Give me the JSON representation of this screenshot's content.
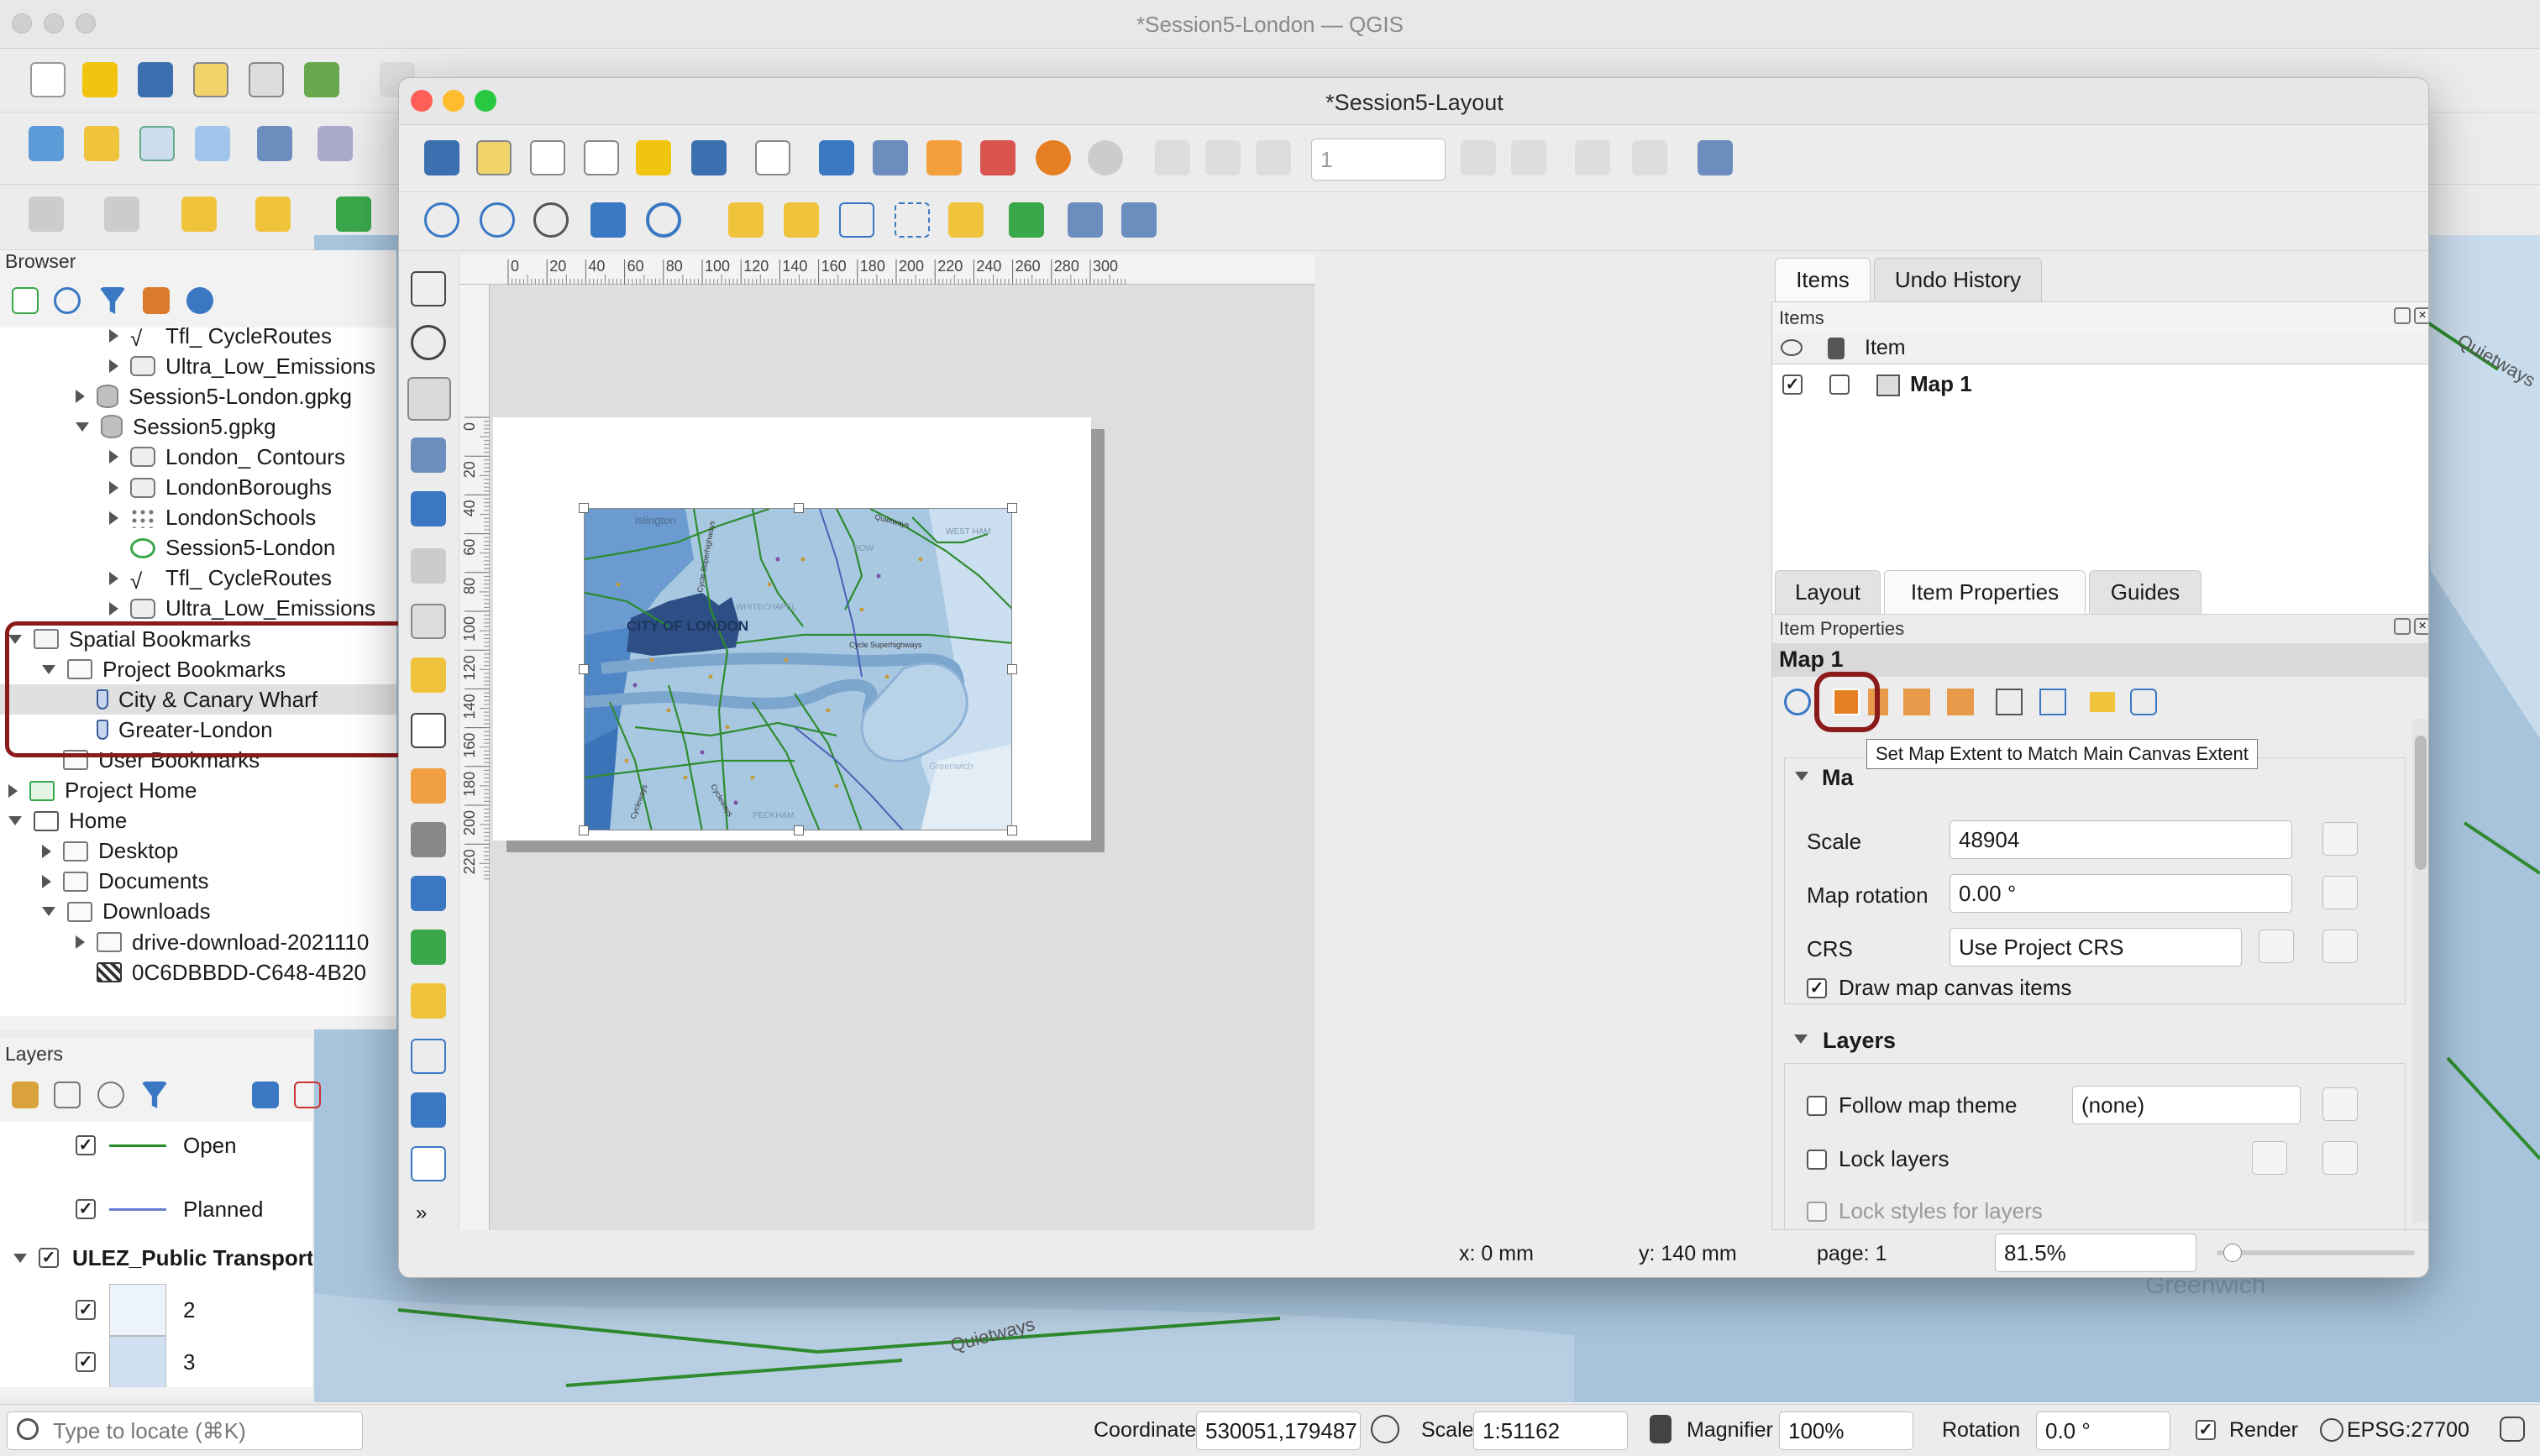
{
  "main_window": {
    "title": "*Session5-London — QGIS"
  },
  "layout_window": {
    "title": "*Session5-Layout",
    "page_input": "1"
  },
  "browser": {
    "title": "Browser",
    "rows": [
      {
        "label": "Tfl_ CycleRoutes",
        "indent": 3,
        "expander": "right",
        "icon": "line-layer-icon"
      },
      {
        "label": "Ultra_Low_Emissions",
        "indent": 3,
        "expander": "right",
        "icon": "polygon-layer-icon"
      },
      {
        "label": "Session5-London.gpkg",
        "indent": 2,
        "expander": "right",
        "icon": "database-icon"
      },
      {
        "label": "Session5.gpkg",
        "indent": 2,
        "expander": "down",
        "icon": "database-icon"
      },
      {
        "label": "London_ Contours",
        "indent": 3,
        "expander": "right",
        "icon": "polygon-layer-icon"
      },
      {
        "label": "LondonBoroughs",
        "indent": 3,
        "expander": "right",
        "icon": "polygon-layer-icon"
      },
      {
        "label": "LondonSchools",
        "indent": 3,
        "expander": "right",
        "icon": "point-layer-icon"
      },
      {
        "label": "Session5-London",
        "indent": 3,
        "expander": "none",
        "icon": "qgis-project-icon"
      },
      {
        "label": "Tfl_ CycleRoutes",
        "indent": 3,
        "expander": "right",
        "icon": "line-layer-icon"
      },
      {
        "label": "Ultra_Low_Emissions",
        "indent": 3,
        "expander": "right",
        "icon": "polygon-layer-icon"
      },
      {
        "label": "Spatial Bookmarks",
        "indent": 0,
        "expander": "down",
        "icon": "bookmark-folder-icon"
      },
      {
        "label": "Project Bookmarks",
        "indent": 1,
        "expander": "down",
        "icon": "folder-icon"
      },
      {
        "label": "City & Canary Wharf",
        "indent": 2,
        "expander": "none",
        "icon": "bookmark-icon",
        "selected": true
      },
      {
        "label": "Greater-London",
        "indent": 2,
        "expander": "none",
        "icon": "bookmark-icon"
      },
      {
        "label": "User Bookmarks",
        "indent": 1,
        "expander": "none",
        "icon": "folder-icon"
      },
      {
        "label": "Project Home",
        "indent": 0,
        "expander": "right",
        "icon": "project-home-icon"
      },
      {
        "label": "Home",
        "indent": 0,
        "expander": "down",
        "icon": "home-icon"
      },
      {
        "label": "Desktop",
        "indent": 1,
        "expander": "right",
        "icon": "folder-icon"
      },
      {
        "label": "Documents",
        "indent": 1,
        "expander": "right",
        "icon": "folder-icon"
      },
      {
        "label": "Downloads",
        "indent": 1,
        "expander": "down",
        "icon": "folder-icon"
      },
      {
        "label": "drive-download-2021110",
        "indent": 2,
        "expander": "right",
        "icon": "folder-icon"
      },
      {
        "label": "0C6DBBDD-C648-4B20",
        "indent": 2,
        "expander": "none",
        "icon": "raster-icon"
      }
    ]
  },
  "layers": {
    "title": "Layers",
    "rows": [
      {
        "label": "Open",
        "checked": true,
        "symbol": "green-line"
      },
      {
        "label": "Planned",
        "checked": true,
        "symbol": "blue-line"
      },
      {
        "label": "ULEZ_Public Transport Ac",
        "checked": true,
        "symbol": "group"
      },
      {
        "label": "2",
        "checked": true,
        "symbol": "swatch-light"
      },
      {
        "label": "3",
        "checked": true,
        "symbol": "swatch-mid"
      }
    ]
  },
  "items_panel": {
    "tabs": [
      "Items",
      "Undo History"
    ],
    "active_tab": "Items",
    "section": "Items",
    "col_item": "Item",
    "rows": [
      {
        "label": "Map 1",
        "visible": true,
        "locked": false
      }
    ]
  },
  "props_panel": {
    "tabs": [
      "Layout",
      "Item Properties",
      "Guides"
    ],
    "active_tab": "Item Properties",
    "section": "Item Properties",
    "item_name": "Map 1",
    "tooltip": "Set Map Extent to Match Main Canvas Extent",
    "main_section_partial": "Ma",
    "scale_label": "Scale",
    "scale_value": "48904",
    "rotation_label": "Map rotation",
    "rotation_value": "0.00 °",
    "crs_label": "CRS",
    "crs_value": "Use Project CRS",
    "draw_items_label": "Draw map canvas items",
    "draw_items_checked": true,
    "layers_section": "Layers",
    "follow_theme_label": "Follow map theme",
    "follow_theme_value": "(none)",
    "lock_layers_label": "Lock layers",
    "lock_styles_label": "Lock styles for layers"
  },
  "layout_status": {
    "x": "x: 0 mm",
    "y": "y: 140 mm",
    "page": "page: 1",
    "zoom": "81.5%"
  },
  "ruler": {
    "h_ticks": [
      "0",
      "20",
      "40",
      "60",
      "80",
      "100",
      "120",
      "140",
      "160",
      "180",
      "200",
      "220",
      "240",
      "260",
      "280",
      "300"
    ],
    "v_ticks": [
      "0",
      "20",
      "40",
      "60",
      "80",
      "100",
      "120",
      "140",
      "160",
      "180",
      "200",
      "220"
    ]
  },
  "map_labels": [
    "Islington",
    "CITY OF LONDON",
    "Cycle Superhighways",
    "Quietways",
    "WEST HAM",
    "BOW",
    "Cycle Superhighways",
    "WHITECHAPEL",
    "Greenwich",
    "PECKHAM",
    "Cycleways",
    "Cycleways"
  ],
  "statusbar": {
    "locate_placeholder": "Type to locate (⌘K)",
    "coordinate_label": "Coordinate",
    "coordinate_value": "530051,179487",
    "scale_label": "Scale",
    "scale_value": "1:51162",
    "magnifier_label": "Magnifier",
    "magnifier_value": "100%",
    "rotation_label": "Rotation",
    "rotation_value": "0.0 °",
    "render_label": "Render",
    "render_checked": true,
    "crs": "EPSG:27700"
  },
  "bg_map_labels": [
    "Quietways",
    "Quietways",
    "Greenwich"
  ],
  "colors": {
    "highlight": "#8b1a1a",
    "map_water": "#a7c4dc",
    "borough_dark": "#2d4f86",
    "route_green": "#2e8b2e"
  }
}
